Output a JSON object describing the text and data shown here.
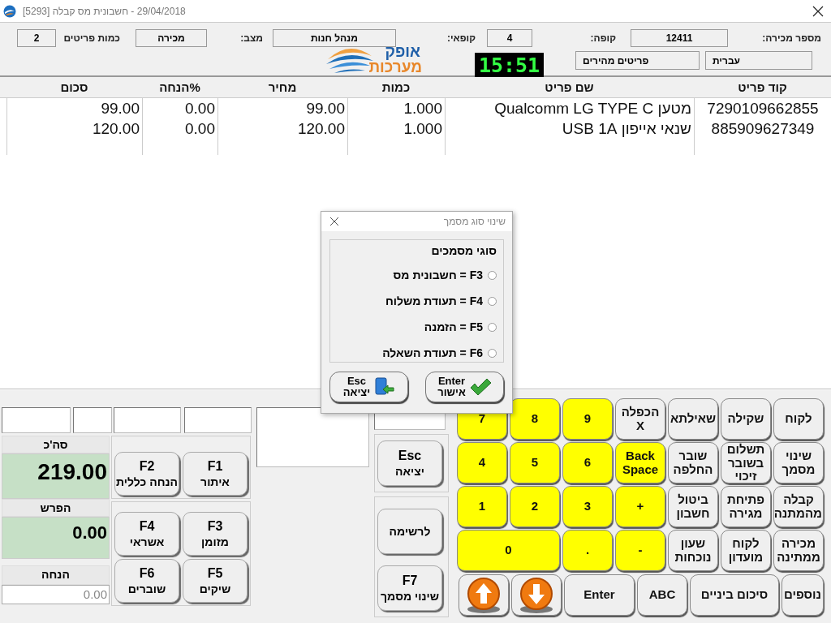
{
  "window": {
    "title": "29/04/2018 - חשבונית מס קבלה [5293]"
  },
  "header": {
    "sale_number_label": "מספר מכירה:",
    "sale_number": "12411",
    "register_label": "קופה:",
    "register": "4",
    "cashier_label": "קופאי:",
    "cashier": "מנהל חנות",
    "mode_label": "מצב:",
    "mode": "מכירה",
    "item_count_label": "כמות פריטים",
    "item_count": "2",
    "language_button": "עברית",
    "quick_items_button": "פריטים מהירים",
    "clock": "15:51",
    "logo": {
      "line1": "אופק",
      "line2": "מערכות"
    }
  },
  "table": {
    "columns": [
      "קוד פריט",
      "שם פריט",
      "כמות",
      "מחיר",
      "%הנחה",
      "סכום"
    ],
    "rows": [
      [
        "7290109662855",
        "מטען Qualcomm LG TYPE C",
        "1.000",
        "99.00",
        "0.00",
        "99.00"
      ],
      [
        "885909627349",
        "שנאי אייפון USB 1A",
        "1.000",
        "120.00",
        "0.00",
        "120.00"
      ]
    ]
  },
  "totals": {
    "total_label": "סה'כ",
    "total": "219.00",
    "change_label": "הפרש",
    "change": "0.00",
    "discount_label": "הנחה",
    "discount": "0.00"
  },
  "function_buttons": [
    {
      "key": "F1",
      "label": "איתור"
    },
    {
      "key": "F2",
      "label": "הנחה כללית"
    },
    {
      "key": "F3",
      "label": "מזומן"
    },
    {
      "key": "F4",
      "label": "אשראי"
    },
    {
      "key": "F5",
      "label": "שיקים"
    },
    {
      "key": "F6",
      "label": "שוברים"
    }
  ],
  "side_buttons": [
    {
      "key": "Esc",
      "label": "יציאה"
    },
    {
      "label": "לרשימה"
    },
    {
      "key": "F7",
      "label": "שינוי מסמך"
    }
  ],
  "keypad": [
    {
      "kind": "action",
      "label": "לקוח"
    },
    {
      "kind": "action",
      "label": "שקילה"
    },
    {
      "kind": "action",
      "label": "שאילתא"
    },
    {
      "kind": "action",
      "label": "הכפלה X"
    },
    {
      "kind": "numeric",
      "label": "9"
    },
    {
      "kind": "numeric",
      "label": "8"
    },
    {
      "kind": "numeric",
      "label": "7"
    },
    {
      "kind": "action",
      "label": "שינוי מסמך"
    },
    {
      "kind": "action",
      "label": "תשלום בשובר זיכוי"
    },
    {
      "kind": "action",
      "label": "שובר החלפה"
    },
    {
      "kind": "numeric",
      "label": "Back Space"
    },
    {
      "kind": "numeric",
      "label": "6"
    },
    {
      "kind": "numeric",
      "label": "5"
    },
    {
      "kind": "numeric",
      "label": "4"
    },
    {
      "kind": "action",
      "label": "קבלה מהמתנה"
    },
    {
      "kind": "action",
      "label": "פתיחת מגירה"
    },
    {
      "kind": "action",
      "label": "ביטול חשבון"
    },
    {
      "kind": "numeric",
      "label": "+"
    },
    {
      "kind": "numeric",
      "label": "3"
    },
    {
      "kind": "numeric",
      "label": "2"
    },
    {
      "kind": "numeric",
      "label": "1"
    },
    {
      "kind": "action",
      "label": "מכירה ממתינה"
    },
    {
      "kind": "action",
      "label": "לקוח מועדון"
    },
    {
      "kind": "action",
      "label": "שעון נוכחות"
    },
    {
      "kind": "numeric",
      "label": "-"
    },
    {
      "kind": "numeric",
      "label": "."
    },
    {
      "kind": "wide_numeric",
      "label": "0"
    }
  ],
  "bottom_keys": [
    {
      "kind": "action",
      "label": "נוספים"
    },
    {
      "kind": "action",
      "label": "סיכום ביניים"
    },
    {
      "kind": "action",
      "label": "ABC"
    },
    {
      "kind": "action",
      "label": "Enter"
    },
    {
      "kind": "arrow_down"
    },
    {
      "kind": "arrow_up"
    }
  ],
  "dialog": {
    "title": "שינוי סוג מסמך",
    "group_label": "סוגי מסמכים",
    "options": [
      {
        "label": "F3 = חשבונית מס",
        "selected": false
      },
      {
        "label": "F4 = תעודת משלוח",
        "selected": false
      },
      {
        "label": "F5 = הזמנה",
        "selected": false
      },
      {
        "label": "F6 = תעודת השאלה",
        "selected": false
      }
    ],
    "buttons": [
      {
        "kind": "confirm",
        "key": "Enter",
        "label": "אישור"
      },
      {
        "kind": "cancel",
        "key": "Esc",
        "label": "יציאה"
      }
    ]
  }
}
